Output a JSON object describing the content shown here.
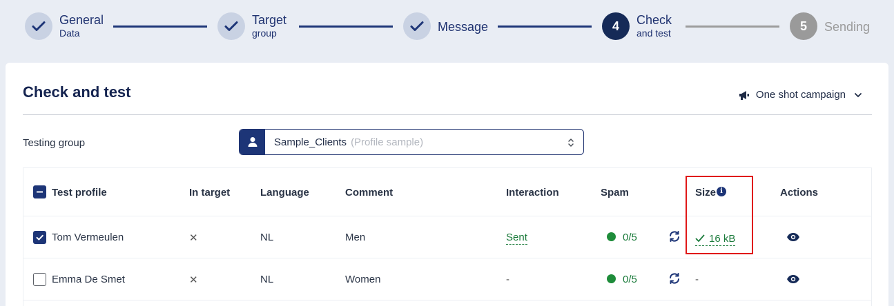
{
  "stepper": {
    "steps": [
      {
        "number": "1",
        "title": "General",
        "subtitle": "Data",
        "state": "done"
      },
      {
        "number": "2",
        "title": "Target",
        "subtitle": "group",
        "state": "done"
      },
      {
        "number": "3",
        "title": "Message",
        "subtitle": "",
        "state": "done"
      },
      {
        "number": "4",
        "title": "Check",
        "subtitle": "and test",
        "state": "active"
      },
      {
        "number": "5",
        "title": "Sending",
        "subtitle": "",
        "state": "pending"
      }
    ]
  },
  "page": {
    "title": "Check and test",
    "campaign_label": "One shot campaign",
    "campaign_icon": "megaphone-icon"
  },
  "testing_group": {
    "label": "Testing group",
    "selected_value": "Sample_Clients",
    "selected_hint": "(Profile sample)"
  },
  "table": {
    "headers": {
      "test_profile": "Test profile",
      "in_target": "In target",
      "language": "Language",
      "comment": "Comment",
      "interaction": "Interaction",
      "spam": "Spam",
      "size": "Size",
      "size_info": "i",
      "actions": "Actions"
    },
    "rows": [
      {
        "name": "Tom Vermeulen",
        "checked": true,
        "in_target": "✕",
        "language": "NL",
        "comment": "Men",
        "interaction": "Sent",
        "spam": "0/5",
        "size": "16 kB"
      },
      {
        "name": "Emma De Smet",
        "checked": false,
        "in_target": "✕",
        "language": "NL",
        "comment": "Women",
        "interaction": "-",
        "spam": "0/5",
        "size": "-"
      }
    ]
  },
  "colors": {
    "primary": "#1d3577",
    "success": "#1e8c3a",
    "highlight": "#e01717"
  }
}
